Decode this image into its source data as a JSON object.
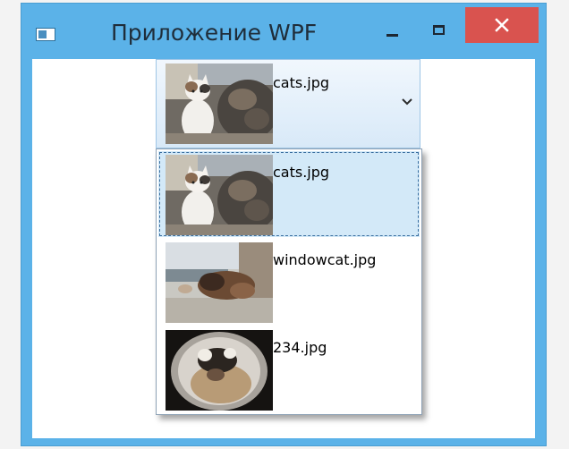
{
  "window": {
    "title": "Приложение WPF",
    "icon": "app-window-icon",
    "controls": {
      "minimize": "minimize-icon",
      "maximize": "maximize-icon",
      "close": "close-icon"
    }
  },
  "combo": {
    "selected": {
      "label": "cats.jpg",
      "thumbnail": "cats-photo"
    },
    "dropdown_icon": "chevron-down-icon",
    "items": [
      {
        "label": "cats.jpg",
        "thumbnail": "cats-photo",
        "selected": true
      },
      {
        "label": "windowcat.jpg",
        "thumbnail": "windowcat-photo",
        "selected": false
      },
      {
        "label": "234.jpg",
        "thumbnail": "bowl-cat-photo",
        "selected": false
      }
    ]
  },
  "colors": {
    "title_bar": "#5bb2e8",
    "close_button": "#d9534f",
    "selection": "#d3e9f8"
  }
}
